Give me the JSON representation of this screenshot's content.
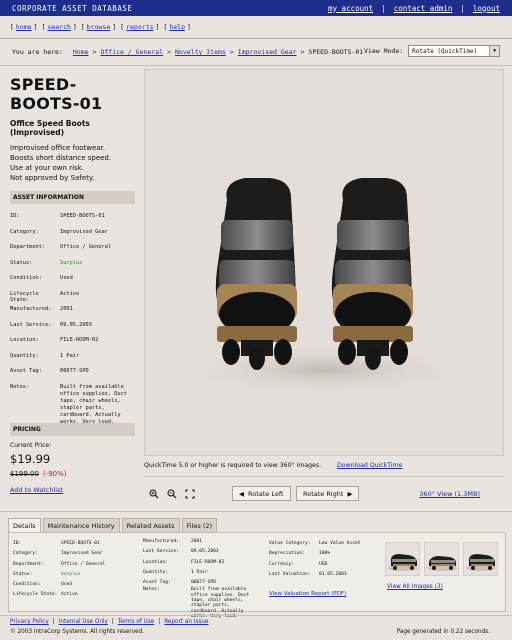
{
  "app": {
    "title": "CORPORATE ASSET DATABASE",
    "account_links": [
      "my_account",
      "contact_admin",
      "logout"
    ]
  },
  "nav": [
    "home",
    "search",
    "browse",
    "reports",
    "help"
  ],
  "breadcrumb": {
    "prefix": "You are here:",
    "items": [
      "Home",
      "Office / General",
      "Novelty Items",
      "Improvised Gear"
    ],
    "current": "SPEED-BOOTS-01"
  },
  "view_mode": {
    "label": "View Mode:",
    "value": "Rotate (QuickTime)"
  },
  "item": {
    "id": "SPEED-BOOTS-01",
    "subtitle": "Office Speed Boots (Improvised)",
    "description": [
      "Improvised office footwear.",
      "Boosts short distance speed.",
      "Use at your own risk.",
      "Not approved by Safety."
    ]
  },
  "asset_info": {
    "heading": "ASSET INFORMATION",
    "rows": [
      {
        "k": "ID:",
        "v": "SPEED-BOOTS-01"
      },
      {
        "k": "Category:",
        "v": "Improvised Gear"
      },
      {
        "k": "Department:",
        "v": "Office / General"
      },
      {
        "k": "Status:",
        "v": "Surplus"
      },
      {
        "k": "Condition:",
        "v": "Used"
      },
      {
        "k": "Lifecycle State:",
        "v": "Active"
      },
      {
        "k": "Manufactured:",
        "v": "2001"
      },
      {
        "k": "Last Service:",
        "v": "09.05.2003"
      },
      {
        "k": "Location:",
        "v": "FILE-ROOM-02"
      },
      {
        "k": "Quantity:",
        "v": "1 Pair"
      },
      {
        "k": "Asset Tag:",
        "v": "00077-SPD"
      },
      {
        "k": "Notes:",
        "v": "Built from available office supplies. Duct tape, chair wheels, stapler parts, cardboard. Actually works. Very loud."
      }
    ],
    "status_color": "#1f8a2a"
  },
  "pricing": {
    "heading": "PRICING",
    "label": "Current Price:",
    "price": "$19.99",
    "original": "$199.00",
    "discount": "(-90%)",
    "discount_color": "#d21414",
    "watchlist": "Add to Watchlist"
  },
  "viewer": {
    "note": "QuickTime 5.0 or higher is required to view 360° images.",
    "download": "Download QuickTime",
    "rotate_left": "Rotate Left",
    "rotate_right": "Rotate Right",
    "view360": "360° View (1.3MB)"
  },
  "tabs": [
    "Details",
    "Maintenance History",
    "Related Assets",
    "Files (2)"
  ],
  "details": {
    "col1": [
      {
        "k": "ID:",
        "v": "SPEED-BOOTS-01"
      },
      {
        "k": "Category:",
        "v": "Improvised Gear"
      },
      {
        "k": "Department:",
        "v": "Office / General"
      },
      {
        "k": "Status:",
        "v": "Surplus"
      },
      {
        "k": "Condition:",
        "v": "Used"
      },
      {
        "k": "Lifecycle State:",
        "v": "Active"
      }
    ],
    "col2": [
      {
        "k": "Manufactured:",
        "v": "2001"
      },
      {
        "k": "Last Service:",
        "v": "09.05.2003"
      },
      {
        "k": "Location:",
        "v": "FILE-ROOM-02"
      },
      {
        "k": "Quantity:",
        "v": "1 Pair"
      },
      {
        "k": "Asset Tag:",
        "v": "00077-SPD"
      },
      {
        "k": "Notes:",
        "v": "Built from available office supplies. Duct tape, chair wheels, stapler parts, cardboard. Actually works. Very loud."
      }
    ],
    "col3": [
      {
        "k": "Value Category:",
        "v": "Low Value Asset"
      },
      {
        "k": "Depreciation:",
        "v": "100%"
      },
      {
        "k": "Currency:",
        "v": "USD"
      },
      {
        "k": "Last Valuation:",
        "v": "01.05.2003"
      }
    ],
    "valuation_report": "View Valuation Report (PDF)",
    "view_all_images": "View All Images (3)"
  },
  "footer": {
    "links": [
      "Privacy Policy",
      "Internal Use Only",
      "Terms of Use",
      "Report an Issue"
    ],
    "copyright": "© 2003 IntraCorp Systems. All rights reserved.",
    "generated": "Page generated in 0.22 seconds."
  }
}
